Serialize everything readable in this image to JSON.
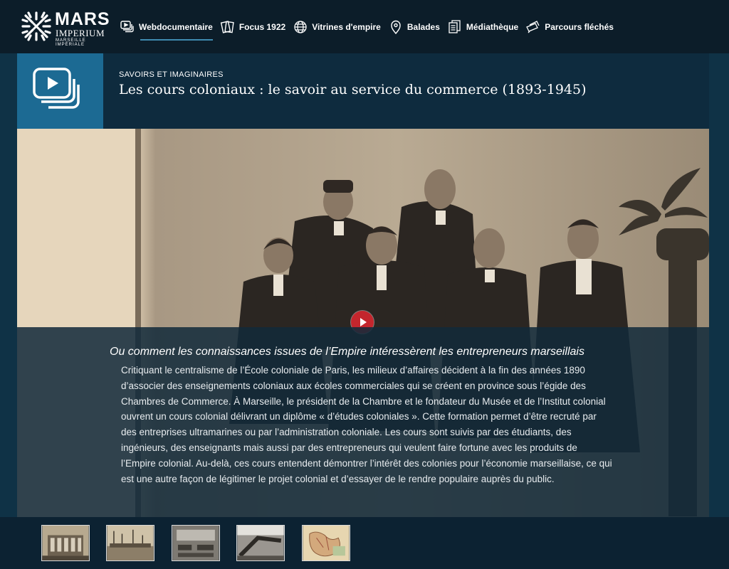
{
  "logo": {
    "title": "MARS",
    "subtitle": "IMPERIUM",
    "tagline": "MARSEILLE IMPÉRIALE"
  },
  "nav": {
    "items": [
      {
        "label": "Webdocumentaire",
        "icon": "video-stack-icon",
        "active": true
      },
      {
        "label": "Focus 1922",
        "icon": "cards-icon",
        "active": false
      },
      {
        "label": "Vitrines d'empire",
        "icon": "globe-icon",
        "active": false
      },
      {
        "label": "Balades",
        "icon": "map-pin-icon",
        "active": false
      },
      {
        "label": "Médiathèque",
        "icon": "documents-icon",
        "active": false
      },
      {
        "label": "Parcours fléchés",
        "icon": "tickets-icon",
        "active": false
      }
    ]
  },
  "header": {
    "kicker": "SAVOIRS ET IMAGINAIRES",
    "title": "Les cours coloniaux : le savoir au service du commerce (1893-1945)",
    "icon": "video-stack-icon"
  },
  "article": {
    "subtitle": "Ou comment les connaissances issues de l’Empire intéressèrent les entrepreneurs marseillais",
    "body": "Critiquant le centralisme de l’École coloniale de Paris, les milieux d’affaires décident à la fin des années 1890 d’associer des enseignements coloniaux aux écoles commerciales qui se créent en province sous l’égide des Chambres de Commerce. À Marseille, le président de la Chambre et le fondateur du Musée et de l’Institut colonial ouvrent un cours colonial délivrant un diplôme « d’études coloniales ». Cette formation permet d’être recruté par des entreprises ultramarines ou par l’administration coloniale. Les cours sont suivis par des étudiants, des ingénieurs, des enseignants mais aussi par des entrepreneurs qui veulent faire fortune avec les produits de l’Empire colonial. Au-delà, ces cours entendent démontrer l’intérêt des colonies pour l’économie marseillaise, ce qui est une autre façon de légitimer le projet colonial et d’essayer de le rendre populaire auprès du public."
  },
  "media": {
    "play_icon": "play-icon",
    "thumbnails": [
      {
        "name": "thumb-building"
      },
      {
        "name": "thumb-harbor"
      },
      {
        "name": "thumb-classroom"
      },
      {
        "name": "thumb-hall"
      },
      {
        "name": "thumb-map"
      }
    ]
  },
  "colors": {
    "nav_bg": "#0c1d29",
    "header_bg": "#0e2b3e",
    "accent": "#1c6a93",
    "play": "#c4262d"
  }
}
